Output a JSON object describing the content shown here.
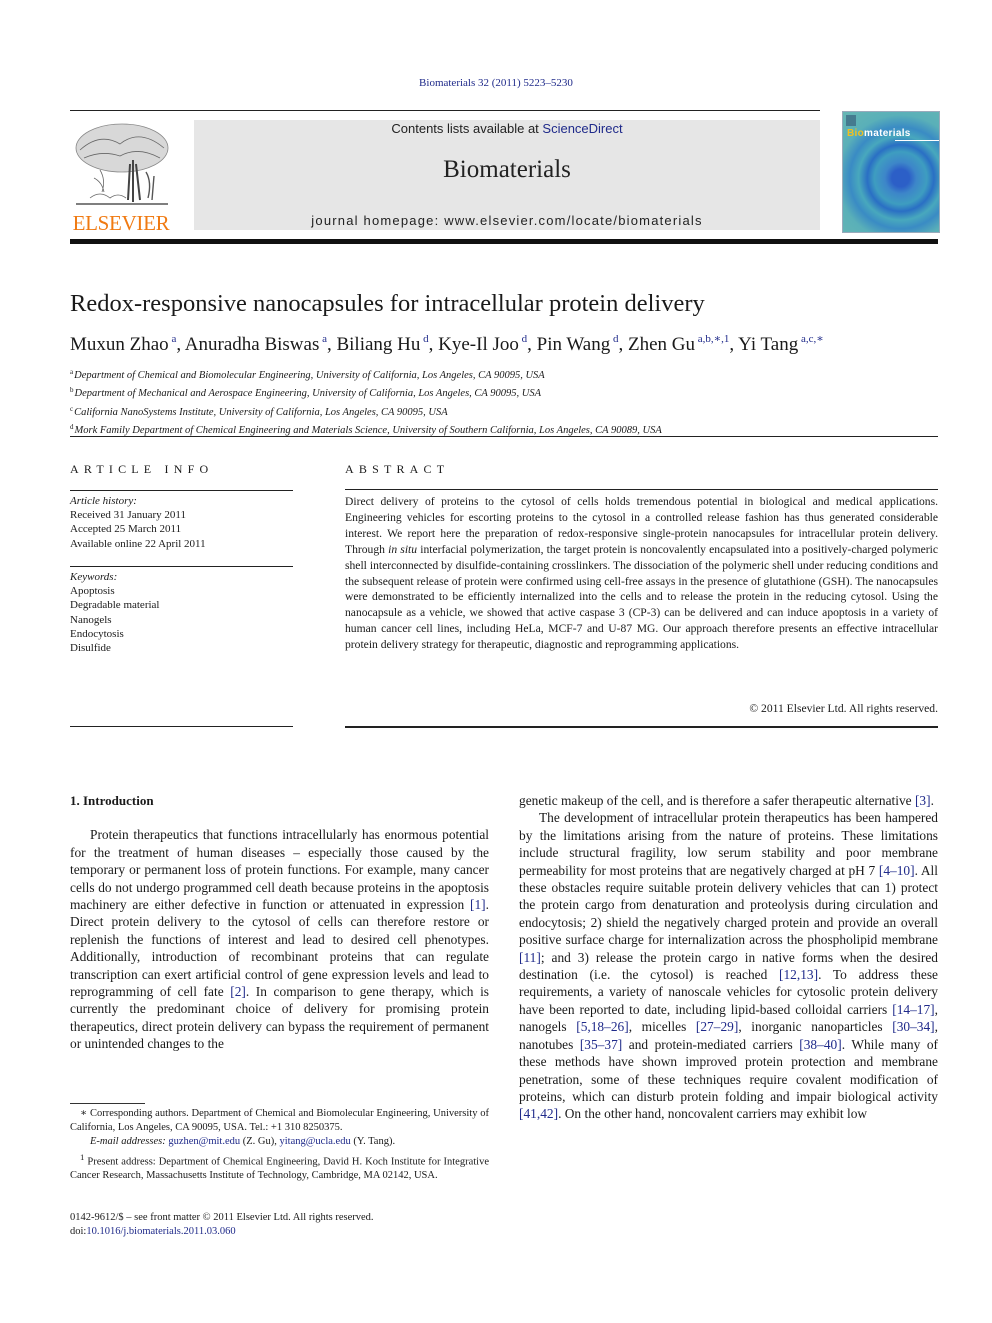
{
  "citation": "Biomaterials 32 (2011) 5223–5230",
  "header": {
    "publisher_logo_text": "ELSEVIER",
    "contents_prefix": "Contents lists available at ",
    "contents_link": "ScienceDirect",
    "journal_title": "Biomaterials",
    "homepage_text": "journal homepage: www.elsevier.com/locate/biomaterials",
    "cover": {
      "title_highlight": "Bio",
      "title_rest": "materials",
      "highlight_color": "#f0c020"
    }
  },
  "article": {
    "title": "Redox-responsive nanocapsules for intracellular protein delivery",
    "authors": [
      {
        "name": "Muxun Zhao",
        "marks": "a",
        "sep": ", "
      },
      {
        "name": "Anuradha Biswas",
        "marks": "a",
        "sep": ", "
      },
      {
        "name": "Biliang Hu",
        "marks": "d",
        "sep": ", "
      },
      {
        "name": "Kye-Il Joo",
        "marks": "d",
        "sep": ", "
      },
      {
        "name": "Pin Wang",
        "marks": "d",
        "sep": ", "
      },
      {
        "name": "Zhen Gu",
        "marks": "a,b,∗,1",
        "sep": ", "
      },
      {
        "name": "Yi Tang",
        "marks": "a,c,∗",
        "sep": ""
      }
    ],
    "affiliations": [
      {
        "mark": "a",
        "text": "Department of Chemical and Biomolecular Engineering, University of California, Los Angeles, CA 90095, USA"
      },
      {
        "mark": "b",
        "text": "Department of Mechanical and Aerospace Engineering, University of California, Los Angeles, CA 90095, USA"
      },
      {
        "mark": "c",
        "text": "California NanoSystems Institute, University of California, Los Angeles, CA 90095, USA"
      },
      {
        "mark": "d",
        "text": "Mork Family Department of Chemical Engineering and Materials Science, University of Southern California, Los Angeles, CA 90089, USA"
      }
    ]
  },
  "article_info": {
    "label": "ARTICLE INFO",
    "history_heading": "Article history:",
    "history": [
      "Received 31 January 2011",
      "Accepted 25 March 2011",
      "Available online 22 April 2011"
    ],
    "keywords_heading": "Keywords:",
    "keywords": [
      "Apoptosis",
      "Degradable material",
      "Nanogels",
      "Endocytosis",
      "Disulfide"
    ]
  },
  "abstract": {
    "label": "ABSTRACT",
    "part1": "Direct delivery of proteins to the cytosol of cells holds tremendous potential in biological and medical applications. Engineering vehicles for escorting proteins to the cytosol in a controlled release fashion has thus generated considerable interest. We report here the preparation of redox-responsive single-protein nanocapsules for intracellular protein delivery. Through ",
    "italic": "in situ",
    "part2": " interfacial polymerization, the target protein is noncovalently encapsulated into a positively-charged polymeric shell interconnected by disulfide-containing crosslinkers. The dissociation of the polymeric shell under reducing conditions and the subsequent release of protein were confirmed using cell-free assays in the presence of glutathione (GSH). The nanocapsules were demonstrated to be efficiently internalized into the cells and to release the protein in the reducing cytosol. Using the nanocapsule as a vehicle, we showed that active caspase 3 (CP-3) can be delivered and can induce apoptosis in a variety of human cancer cell lines, including HeLa, MCF-7 and U-87 MG. Our approach therefore presents an effective intracellular protein delivery strategy for therapeutic, diagnostic and reprogramming applications.",
    "copyright": "© 2011 Elsevier Ltd. All rights reserved."
  },
  "body": {
    "section_heading": "1.  Introduction",
    "left_paragraph": [
      {
        "t": "Protein therapeutics that functions intracellularly has enormous potential for the treatment of human diseases – especially those caused by the temporary or permanent loss of protein functions. For example, many cancer cells do not undergo programmed cell death because proteins in the apoptosis machinery are either defective in function or attenuated in expression "
      },
      {
        "c": "[1]"
      },
      {
        "t": ". Direct protein delivery to the cytosol of cells can therefore restore or replenish the functions of interest and lead to desired cell phenotypes. Additionally, introduction of recombinant proteins that can regulate transcription can exert artificial control of gene expression levels and lead to reprogramming of cell fate "
      },
      {
        "c": "[2]"
      },
      {
        "t": ". In comparison to gene therapy, which is currently the predominant choice of delivery for promising protein therapeutics, direct protein delivery can bypass the requirement of permanent or unintended changes to the"
      }
    ],
    "right_paragraph_1": [
      {
        "t": "genetic makeup of the cell, and is therefore a safer therapeutic alternative "
      },
      {
        "c": "[3]"
      },
      {
        "t": "."
      }
    ],
    "right_paragraph_2": [
      {
        "t": "The development of intracellular protein therapeutics has been hampered by the limitations arising from the nature of proteins. These limitations include structural fragility, low serum stability and poor membrane permeability for most proteins that are negatively charged at pH 7 "
      },
      {
        "c": "[4–10]"
      },
      {
        "t": ". All these obstacles require suitable protein delivery vehicles that can 1) protect the protein cargo from denaturation and proteolysis during circulation and endocytosis; 2) shield the negatively charged protein and provide an overall positive surface charge for internalization across the phospholipid membrane "
      },
      {
        "c": "[11]"
      },
      {
        "t": "; and 3) release the protein cargo in native forms when the desired destination (i.e. the cytosol) is reached "
      },
      {
        "c": "[12,13]"
      },
      {
        "t": ". To address these requirements, a variety of nanoscale vehicles for cytosolic protein delivery have been reported to date, including lipid-based colloidal carriers "
      },
      {
        "c": "[14–17]"
      },
      {
        "t": ", nanogels "
      },
      {
        "c": "[5,18–26]"
      },
      {
        "t": ", micelles "
      },
      {
        "c": "[27–29]"
      },
      {
        "t": ", inorganic nanoparticles "
      },
      {
        "c": "[30–34]"
      },
      {
        "t": ", nanotubes "
      },
      {
        "c": "[35–37]"
      },
      {
        "t": " and protein-mediated carriers "
      },
      {
        "c": "[38–40]"
      },
      {
        "t": ". While many of these methods have shown improved protein protection and membrane penetration, some of these techniques require covalent modification of proteins, which can disturb protein folding and impair biological activity "
      },
      {
        "c": "[41,42]"
      },
      {
        "t": ". On the other hand, noncovalent carriers may exhibit low"
      }
    ]
  },
  "footnotes": {
    "corresponding": "∗  Corresponding authors. Department of Chemical and Biomolecular Engineering, University of California, Los Angeles, CA 90095, USA. Tel.: +1 310 8250375.",
    "email_label": "E-mail addresses:",
    "email_1": "guzhen@mit.edu",
    "email_1_owner": " (Z. Gu), ",
    "email_2": "yitang@ucla.edu",
    "email_2_owner": " (Y. Tang).",
    "present_mark": "1",
    "present_address": "  Present address: Department of Chemical Engineering, David H. Koch Institute for Integrative Cancer Research, Massachusetts Institute of Technology, Cambridge, MA 02142, USA."
  },
  "front_matter": {
    "issn_line": "0142-9612/$ – see front matter © 2011 Elsevier Ltd. All rights reserved.",
    "doi_prefix": "doi:",
    "doi": "10.1016/j.biomaterials.2011.03.060"
  }
}
